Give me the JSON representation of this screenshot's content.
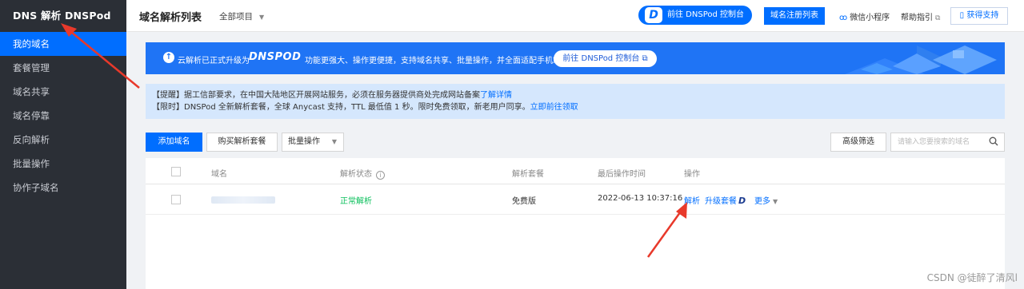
{
  "sidebar": {
    "brand": "DNS 解析 DNSPod",
    "items": [
      {
        "label": "我的域名",
        "active": true
      },
      {
        "label": "套餐管理"
      },
      {
        "label": "域名共享"
      },
      {
        "label": "域名停靠"
      },
      {
        "label": "反向解析"
      },
      {
        "label": "批量操作"
      },
      {
        "label": "协作子域名"
      }
    ]
  },
  "topbar": {
    "title": "域名解析列表",
    "project": "全部项目",
    "console_label": "前往 DNSPod 控制台",
    "register_label": "域名注册列表",
    "mini_program": "微信小程序",
    "help": "帮助指引",
    "support": "获得支持"
  },
  "banner": {
    "text1": "云解析已正式升级为",
    "logo": "DNSPOD",
    "text2": "功能更强大、操作更便捷，支持域名共享、批量操作，并全面适配手机端",
    "button": "前往 DNSPod 控制台"
  },
  "notice": {
    "line1_prefix": "【提醒】据工信部要求，在中国大陆地区开展网站服务，必须在服务器提供商处完成网站备案",
    "line1_link": "了解详情",
    "line2_prefix": "【限时】DNSPod 全新解析套餐，全球 Anycast 支持，TTL 最低值 1 秒。限时免费领取，新老用户同享。",
    "line2_link": "立即前往领取"
  },
  "toolbar": {
    "add": "添加域名",
    "buy": "购买解析套餐",
    "batch": "批量操作",
    "filter": "高级筛选",
    "search_placeholder": "请输入您要搜索的域名"
  },
  "table": {
    "headers": {
      "domain": "域名",
      "status": "解析状态",
      "package": "解析套餐",
      "time": "最后操作时间",
      "ops": "操作"
    },
    "rows": [
      {
        "status": "正常解析",
        "package": "免费版",
        "time": "2022-06-13 10:37:16",
        "op_resolve": "解析",
        "op_upgrade": "升级套餐",
        "op_more": "更多"
      }
    ]
  },
  "watermark": "CSDN @徒醉了清风l",
  "colors": {
    "primary": "#006eff",
    "sidebar": "#2b2f36",
    "annotation": "#e8392b",
    "success": "#0abf5b"
  }
}
